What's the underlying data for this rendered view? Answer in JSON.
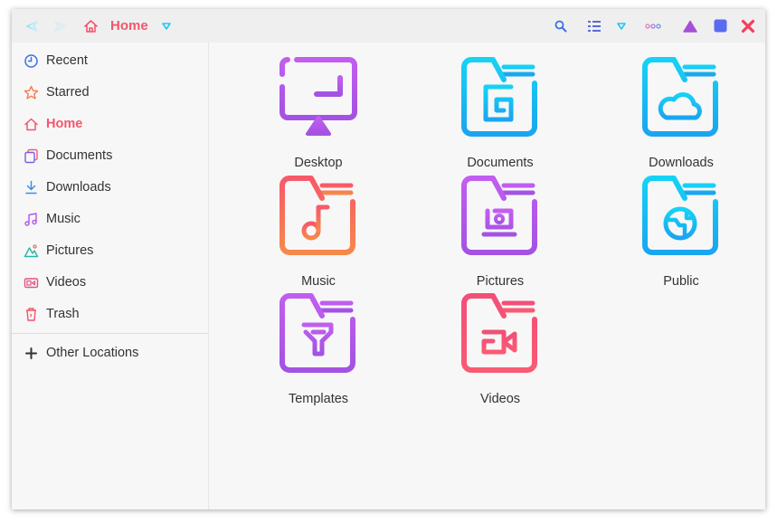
{
  "headerbar": {
    "back_icon": "back-arrow-icon",
    "forward_icon": "forward-arrow-icon",
    "home_icon": "home-icon",
    "location_label": "Home",
    "location_dropdown_icon": "chevron-down-icon",
    "search_icon": "search-icon",
    "view_icon": "list-view-icon",
    "view_dropdown_icon": "chevron-down-icon",
    "menu_icon": "more-icon",
    "minimize_icon": "minimize-icon",
    "maximize_icon": "maximize-icon",
    "close_icon": "close-icon"
  },
  "sidebar": {
    "items": [
      {
        "label": "Recent",
        "icon": "clock-icon"
      },
      {
        "label": "Starred",
        "icon": "star-icon"
      },
      {
        "label": "Home",
        "icon": "home-icon",
        "active": true
      },
      {
        "label": "Documents",
        "icon": "documents-icon"
      },
      {
        "label": "Downloads",
        "icon": "download-icon"
      },
      {
        "label": "Music",
        "icon": "music-icon"
      },
      {
        "label": "Pictures",
        "icon": "pictures-icon"
      },
      {
        "label": "Videos",
        "icon": "video-icon"
      },
      {
        "label": "Trash",
        "icon": "trash-icon"
      }
    ],
    "other_locations": {
      "label": "Other Locations",
      "icon": "plus-icon"
    }
  },
  "folders": [
    {
      "label": "Desktop",
      "icon": "desktop-icon"
    },
    {
      "label": "Documents",
      "icon": "documents-folder-icon"
    },
    {
      "label": "Downloads",
      "icon": "downloads-folder-icon"
    },
    {
      "label": "Music",
      "icon": "music-folder-icon"
    },
    {
      "label": "Pictures",
      "icon": "pictures-folder-icon"
    },
    {
      "label": "Public",
      "icon": "public-folder-icon"
    },
    {
      "label": "Templates",
      "icon": "templates-folder-icon"
    },
    {
      "label": "Videos",
      "icon": "videos-folder-icon"
    }
  ],
  "colors": {
    "accent": "#f2576d",
    "cyan": "#1ec8f3",
    "purple": "#b454e8",
    "orange": "#f76b52",
    "pink": "#f74a78",
    "window_bg": "#f7f7f7",
    "headerbar_bg": "#efefef"
  }
}
